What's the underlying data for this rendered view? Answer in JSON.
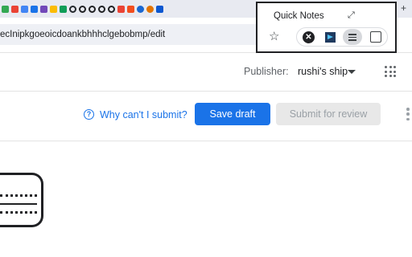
{
  "browser": {
    "tab_favicons": [
      {
        "name": "sheets-favicon",
        "color": "#34a853"
      },
      {
        "name": "gmail-favicon",
        "color": "#ea4335"
      },
      {
        "name": "docs-favicon",
        "color": "#4285f4"
      },
      {
        "name": "calendar-favicon",
        "color": "#1a73e8"
      },
      {
        "name": "forms-favicon",
        "color": "#7248b9"
      },
      {
        "name": "slides-favicon",
        "color": "#fbbc04"
      },
      {
        "name": "drive-favicon",
        "color": "#0f9d58"
      },
      {
        "name": "github-favicon",
        "color": "#24292e",
        "shape": "ring"
      },
      {
        "name": "profile-favicon",
        "color": "#202124",
        "shape": "ring"
      },
      {
        "name": "profile-favicon",
        "color": "#202124",
        "shape": "ring"
      },
      {
        "name": "profile-favicon",
        "color": "#202124",
        "shape": "ring"
      },
      {
        "name": "profile-favicon",
        "color": "#202124",
        "shape": "ring"
      },
      {
        "name": "mail-favicon",
        "color": "#ea4335"
      },
      {
        "name": "figma-favicon",
        "color": "#f24e1e"
      },
      {
        "name": "user-avatar-favicon",
        "color": "#1967d2",
        "shape": "round"
      },
      {
        "name": "user-avatar-favicon",
        "color": "#e37400",
        "shape": "round"
      },
      {
        "name": "app-favicon",
        "color": "#0b57d0"
      }
    ],
    "new_tab_label": "+",
    "url": "ecInipkgoeoicdoankbhhhclgebobmp/edit"
  },
  "header": {
    "publisher_label": "Publisher:",
    "publisher_name": "rushi's ship"
  },
  "actions": {
    "help_icon": "?",
    "help_link": "Why can't I submit?",
    "save_label": "Save draft",
    "submit_label": "Submit for review"
  },
  "popup": {
    "title": "Quick Notes",
    "expand_icon": "⤢",
    "star_icon": "☆",
    "close_icon": "✕"
  },
  "colors": {
    "accent": "#1a73e8",
    "disabled_bg": "#e8e8e8",
    "disabled_text": "#9aa0a6"
  }
}
